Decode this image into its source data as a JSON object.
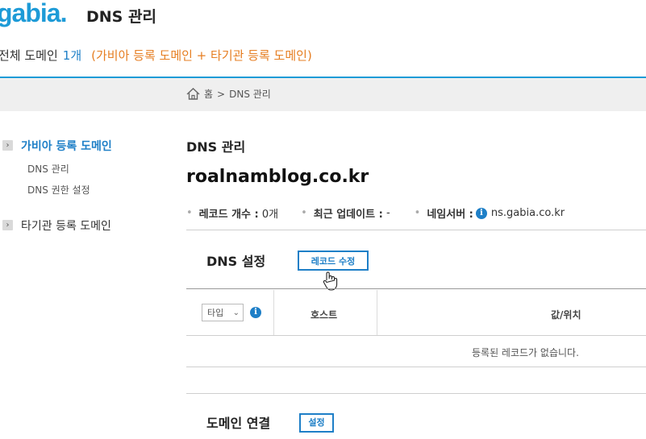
{
  "header": {
    "logo_text": "gabia",
    "logo_dot": ".",
    "app_title": "DNS 관리"
  },
  "summary": {
    "label": "전체 도메인",
    "count": "1개",
    "note": "(가비아 등록 도메인 + 타기관 등록 도메인)"
  },
  "breadcrumb": {
    "home": "홈",
    "separator": ">",
    "current": "DNS 관리"
  },
  "sidebar": {
    "groups": [
      {
        "label": "가비아 등록 도메인",
        "arrow": "›",
        "active": true,
        "items": [
          {
            "label": "DNS 관리"
          },
          {
            "label": "DNS 권한 설정"
          }
        ]
      },
      {
        "label": "타기관 등록 도메인",
        "arrow": "›",
        "active": false,
        "items": []
      }
    ]
  },
  "main": {
    "section_title": "DNS 관리",
    "domain": "roalnamblog.co.kr",
    "meta": {
      "record_count_label": "레코드 개수 :",
      "record_count_value": "0개",
      "last_update_label": "최근 업데이트 :",
      "last_update_value": "-",
      "nameserver_label": "네임서버 :",
      "nameserver_value": "ns.gabia.co.kr",
      "bullet": "•"
    },
    "dns_settings": {
      "title": "DNS 설정",
      "edit_button": "레코드 수정",
      "table": {
        "type_select": "타입",
        "type_arrow": "⌄",
        "info_glyph": "i",
        "columns": [
          "호스트",
          "값/위치"
        ],
        "empty_message": "등록된 레코드가 없습니다."
      }
    },
    "domain_link": {
      "title": "도메인 연결",
      "button": "설정"
    }
  },
  "colors": {
    "accent_blue": "#1e7fc7",
    "logo_blue": "#1e9bd7",
    "note_orange": "#e67e22",
    "breadcrumb_bg": "#efefef"
  },
  "icons": [
    "home-icon",
    "info-icon",
    "chevron-right-icon",
    "chevron-down-icon",
    "hand-cursor-icon"
  ]
}
